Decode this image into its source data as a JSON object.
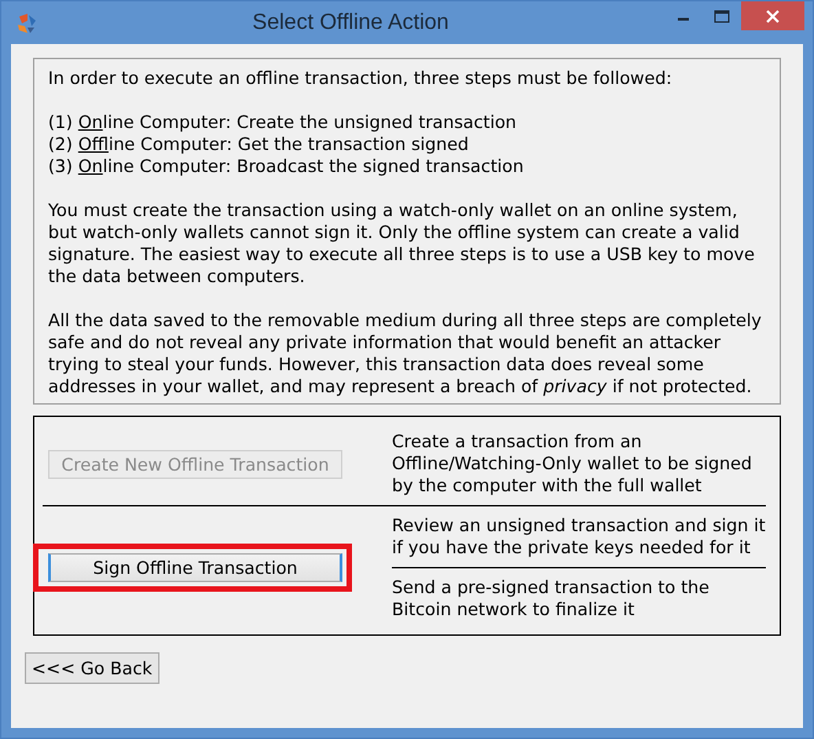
{
  "window": {
    "title": "Select Offline Action"
  },
  "intro": "In order to execute an offline transaction, three steps must be followed:",
  "steps": [
    {
      "number": "(1)",
      "underlined": "On",
      "rest": "line Computer: Create the unsigned transaction"
    },
    {
      "number": "(2)",
      "underlined": "Off",
      "rest": "line Computer: Get the transaction signed"
    },
    {
      "number": "(3)",
      "underlined": "On",
      "rest": "line Computer: Broadcast the signed transaction"
    }
  ],
  "paragraphs": [
    "You must create the transaction using a watch-only wallet on an online system, but watch-only wallets cannot sign it. Only the offline system can create a valid signature. The easiest way to execute all three steps is to use a USB key to move the data between computers.",
    "All the data saved to the removable medium during all three steps are completely safe and do not reveal any private information that would benefit an attacker trying to steal your funds. However, this transaction data does reveal some addresses in your wallet, and may represent a breach of *privacy* if not protected."
  ],
  "actions": [
    {
      "button": "Create New Offline Transaction",
      "disabled": true,
      "focused": false,
      "highlighted": false,
      "description": "Create a transaction from an Offline/Watching-Only wallet to be signed by the computer with the full wallet"
    },
    {
      "button": "Sign Offline Transaction",
      "disabled": false,
      "focused": true,
      "highlighted": true,
      "description": "Review an unsigned transaction and sign it if you have the private keys needed for it"
    },
    {
      "description": "Send a pre-signed transaction to the Bitcoin network to finalize it"
    }
  ],
  "back_button": "<<< Go Back"
}
